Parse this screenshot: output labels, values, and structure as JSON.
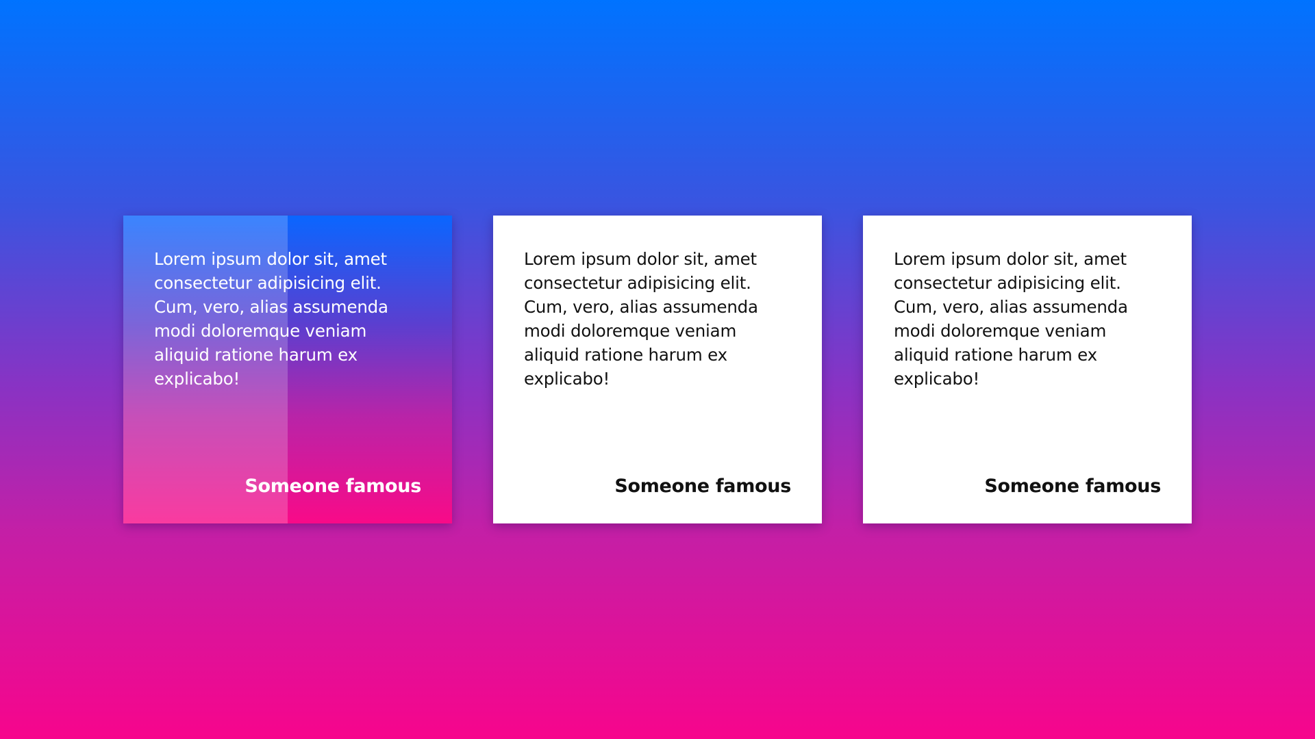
{
  "colors": {
    "background_top": "#0073ff",
    "background_bottom": "#f7058c",
    "card_background": "#ffffff",
    "card_text": "#111111",
    "active_card_text": "#ffffff"
  },
  "cards": [
    {
      "state": "hovered",
      "quote": "Lorem ipsum dolor sit, amet consectetur adipisicing elit. Cum, vero, alias assumenda modi doloremque veniam aliquid ratione harum ex explicabo!",
      "author": "Someone famous"
    },
    {
      "state": "default",
      "quote": "Lorem ipsum dolor sit, amet consectetur adipisicing elit. Cum, vero, alias assumenda modi doloremque veniam aliquid ratione harum ex explicabo!",
      "author": "Someone famous"
    },
    {
      "state": "default",
      "quote": "Lorem ipsum dolor sit, amet consectetur adipisicing elit. Cum, vero, alias assumenda modi doloremque veniam aliquid ratione harum ex explicabo!",
      "author": "Someone famous"
    }
  ]
}
